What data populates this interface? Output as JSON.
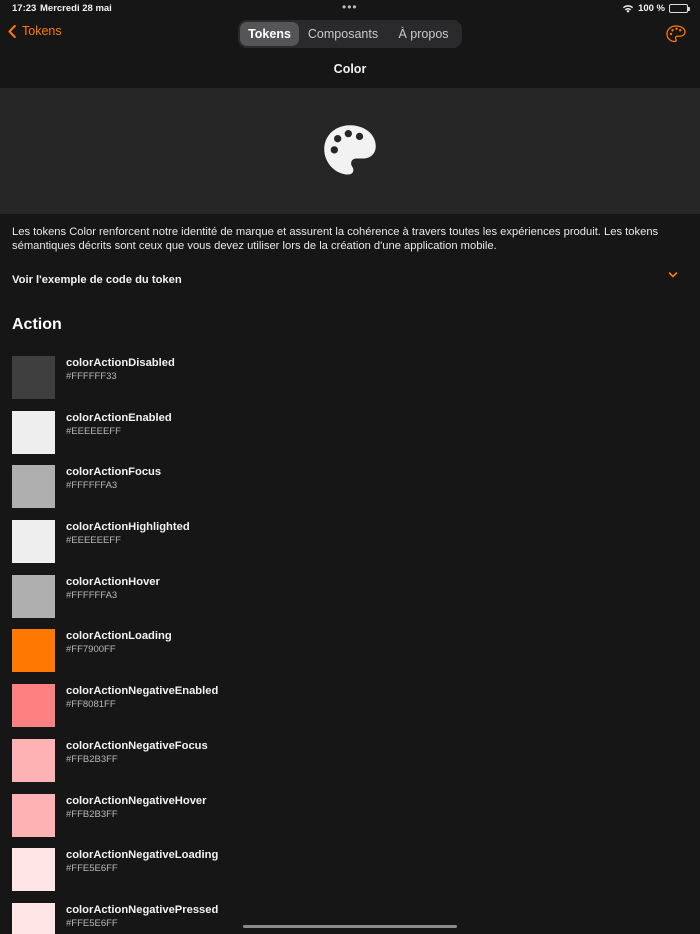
{
  "status": {
    "time": "17:23",
    "date": "Mercredi 28 mai",
    "battery": "100 %"
  },
  "nav": {
    "back_label": "Tokens",
    "tabs": [
      {
        "label": "Tokens",
        "active": true
      },
      {
        "label": "Composants",
        "active": false
      },
      {
        "label": "À propos",
        "active": false
      }
    ],
    "accent": "#FF7900"
  },
  "page": {
    "title": "Color",
    "hero_icon": "palette-icon",
    "description": "Les tokens Color renforcent notre identité de marque et assurent la cohérence à travers toutes les expériences produit. Les tokens sémantiques décrits sont ceux que vous devez utiliser lors de la création d'une application mobile.",
    "code_toggle_label": "Voir l'exemple de code du token",
    "section_title": "Action"
  },
  "tokens": [
    {
      "name": "colorActionDisabled",
      "hex": "#FFFFFF33",
      "swatch": "#3F3F3F"
    },
    {
      "name": "colorActionEnabled",
      "hex": "#EEEEEEFF",
      "swatch": "#EEEEEE"
    },
    {
      "name": "colorActionFocus",
      "hex": "#FFFFFFA3",
      "swatch": "#AFAFAF"
    },
    {
      "name": "colorActionHighlighted",
      "hex": "#EEEEEEFF",
      "swatch": "#EEEEEE"
    },
    {
      "name": "colorActionHover",
      "hex": "#FFFFFFA3",
      "swatch": "#AFAFAF"
    },
    {
      "name": "colorActionLoading",
      "hex": "#FF7900FF",
      "swatch": "#FF7900"
    },
    {
      "name": "colorActionNegativeEnabled",
      "hex": "#FF8081FF",
      "swatch": "#FF8081"
    },
    {
      "name": "colorActionNegativeFocus",
      "hex": "#FFB2B3FF",
      "swatch": "#FFB2B3"
    },
    {
      "name": "colorActionNegativeHover",
      "hex": "#FFB2B3FF",
      "swatch": "#FFB2B3"
    },
    {
      "name": "colorActionNegativeLoading",
      "hex": "#FFE5E6FF",
      "swatch": "#FFE5E6"
    },
    {
      "name": "colorActionNegativePressed",
      "hex": "#FFE5E6FF",
      "swatch": "#FFE5E6"
    }
  ]
}
